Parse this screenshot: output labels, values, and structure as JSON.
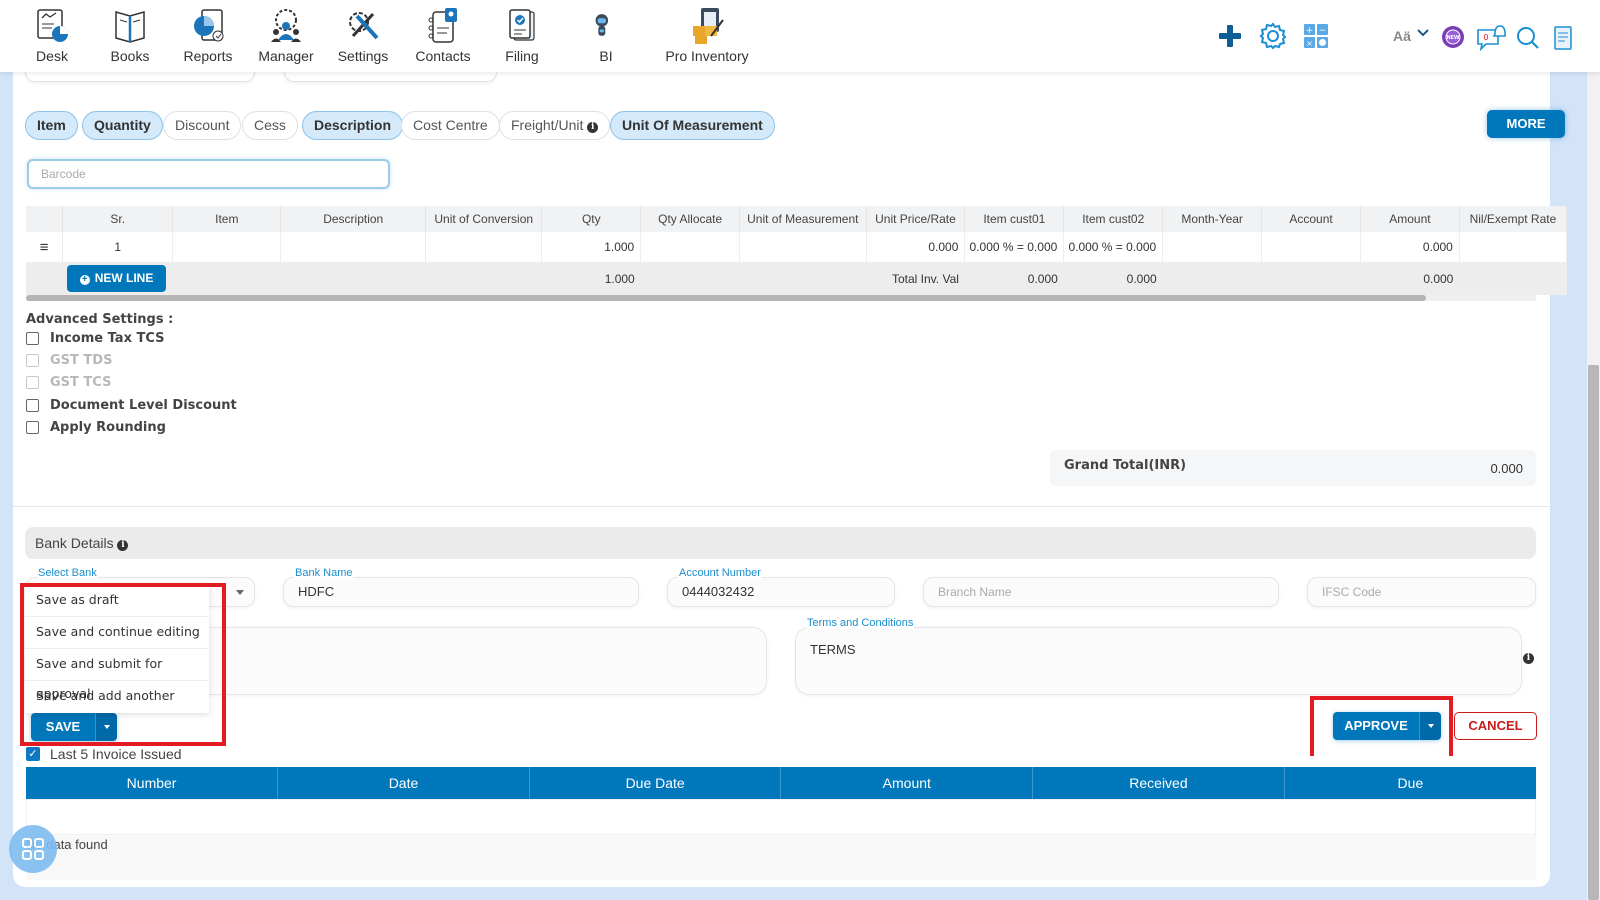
{
  "nav": {
    "items": [
      {
        "label": "Desk",
        "icon": "desk-icon"
      },
      {
        "label": "Books",
        "icon": "books-icon"
      },
      {
        "label": "Reports",
        "icon": "reports-icon"
      },
      {
        "label": "Manager",
        "icon": "manager-icon"
      },
      {
        "label": "Settings",
        "icon": "settings-icon"
      },
      {
        "label": "Contacts",
        "icon": "contacts-icon"
      },
      {
        "label": "Filing",
        "icon": "filing-icon"
      },
      {
        "label": "BI",
        "icon": "bi-robot-icon"
      },
      {
        "label": "Pro Inventory",
        "icon": "pro-inventory-icon"
      }
    ],
    "right": {
      "user_initials": "Aä",
      "notification_count": "0",
      "new_badge": "NEW"
    }
  },
  "chips": [
    {
      "label": "Item",
      "active": true
    },
    {
      "label": "Quantity",
      "active": true
    },
    {
      "label": "Discount",
      "active": false
    },
    {
      "label": "Cess",
      "active": false
    },
    {
      "label": "Description",
      "active": true
    },
    {
      "label": "Cost Centre",
      "active": false
    },
    {
      "label": "Freight/Unit",
      "active": false,
      "info": true
    },
    {
      "label": "Unit Of Measurement",
      "active": true
    }
  ],
  "more_label": "MORE",
  "barcode_placeholder": "Barcode",
  "items_table": {
    "columns": [
      "",
      "Sr.",
      "Item",
      "Description",
      "Unit of Conversion",
      "Qty",
      "Qty Allocate",
      "Unit of Measurement",
      "Unit Price/Rate",
      "Item cust01",
      "Item cust02",
      "Month-Year",
      "Account",
      "Amount",
      "Nil/Exempt Rate"
    ],
    "rows": [
      [
        "≡",
        "1",
        "",
        "",
        "",
        "1.000",
        "",
        "",
        "0.000",
        "0.000 % = 0.000",
        "0.000 % = 0.000",
        "",
        "",
        "0.000",
        ""
      ]
    ],
    "totals": {
      "new_line_label": "NEW LINE",
      "qty": "1.000",
      "label": "Total Inv. Val",
      "cust01": "0.000",
      "cust02": "0.000",
      "amount": "0.000"
    }
  },
  "advanced": {
    "title": "Advanced Settings :",
    "options": [
      {
        "label": "Income Tax TCS",
        "checked": false,
        "disabled": false
      },
      {
        "label": "GST TDS",
        "checked": false,
        "disabled": true
      },
      {
        "label": "GST TCS",
        "checked": false,
        "disabled": true
      },
      {
        "label": "Document Level Discount",
        "checked": false,
        "disabled": false
      },
      {
        "label": "Apply Rounding",
        "checked": false,
        "disabled": false
      }
    ]
  },
  "grand_total": {
    "label": "Grand Total(INR)",
    "value": "0.000"
  },
  "bank": {
    "title": "Bank Details",
    "select_bank_label": "Select Bank",
    "bank_name_label": "Bank Name",
    "bank_name": "HDFC",
    "account_number_label": "Account Number",
    "account_number": "0444032432",
    "branch_placeholder": "Branch Name",
    "ifsc_placeholder": "IFSC Code",
    "terms_label": "Terms and Conditions",
    "terms_value": "TERMS"
  },
  "save_menu": [
    "Save as draft",
    "Save and continue editing",
    "Save and submit for approval",
    "Save and add another"
  ],
  "buttons": {
    "save": "SAVE",
    "approve": "APPROVE",
    "cancel": "CANCEL"
  },
  "last_invoices": {
    "label": "Last 5 Invoice Issued",
    "checked": true,
    "columns": [
      "Number",
      "Date",
      "Due Date",
      "Amount",
      "Received",
      "Due"
    ],
    "empty_text": "No data found"
  },
  "colors": {
    "primary": "#0076bb",
    "danger": "#c81b1b",
    "highlight": "#e31b23",
    "accent_label": "#1a8fcc"
  }
}
